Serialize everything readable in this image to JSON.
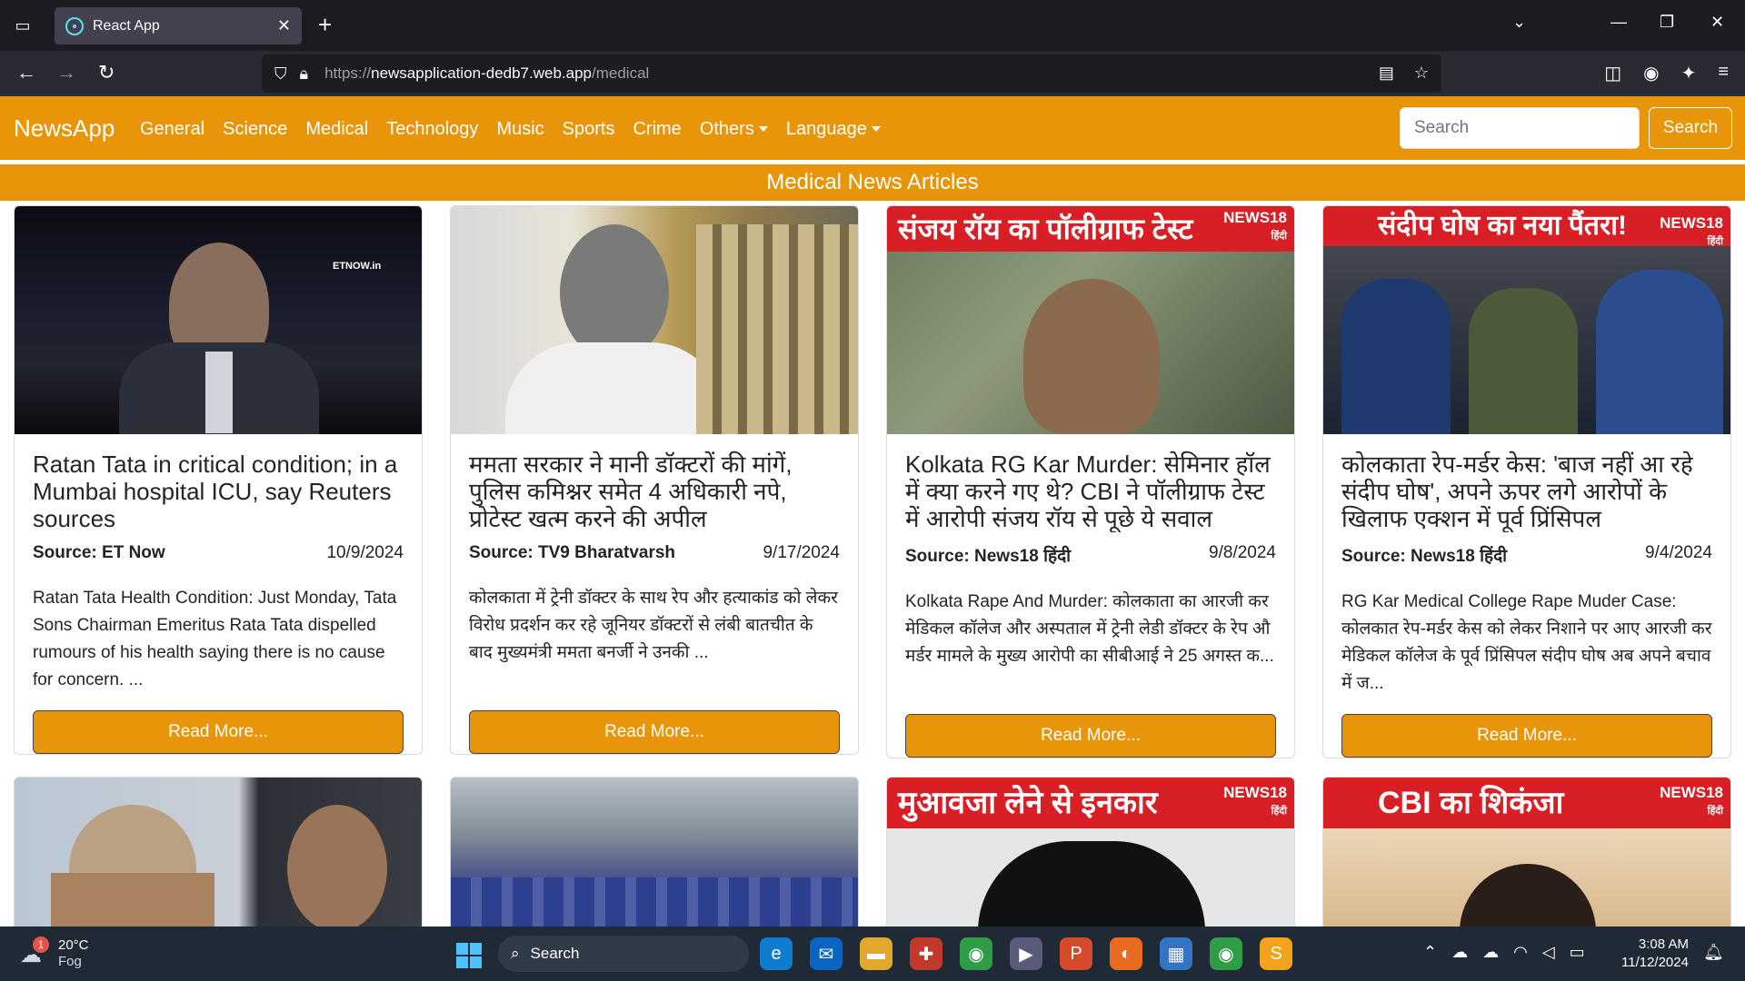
{
  "browser": {
    "tab_title": "React App",
    "url_prefix": "https://",
    "url_host": "newsapplication-dedb7.web.app",
    "url_path": "/medical"
  },
  "app": {
    "brand": "NewsApp",
    "menu": [
      "General",
      "Science",
      "Medical",
      "Technology",
      "Music",
      "Sports",
      "Crime"
    ],
    "others_label": "Others",
    "language_label": "Language",
    "search_placeholder": "Search",
    "search_button": "Search",
    "page_heading": "Medical News Articles"
  },
  "cards": [
    {
      "title": "Ratan Tata in critical condition; in a Mumbai hospital ICU, say Reuters sources",
      "source": "Source: ET Now",
      "date": "10/9/2024",
      "description": "Ratan Tata Health Condition: Just Monday, Tata Sons Chairman Emeritus Rata Tata dispelled rumours of his health saying there is no cause for concern. ...",
      "button": "Read More...",
      "image_overlay": "ETNOW.in"
    },
    {
      "title": "ममता सरकार ने मानी डॉक्टरों की मांगें, पुलिस कमिश्नर समेत 4 अधिकारी नपे, प्रोटेस्ट खत्म करने की अपील",
      "source": "Source: TV9 Bharatvarsh",
      "date": "9/17/2024",
      "description": "कोलकाता में ट्रेनी डॉक्टर के साथ रेप और हत्याकांड को लेकर विरोध प्रदर्शन कर रहे जूनियर डॉक्टरों से लंबी बातचीत के बाद मुख्यमंत्री ममता बनर्जी ने उनकी ...",
      "button": "Read More...",
      "image_overlay": ""
    },
    {
      "title": "Kolkata RG Kar Murder: सेमिनार हॉल में क्या करने गए थे? CBI ने पॉलीग्राफ टेस्ट में आरोपी संजय रॉय से पूछे ये सवाल",
      "source": "Source: News18 हिंदी",
      "date": "9/8/2024",
      "description": "Kolkata Rape And Murder: कोलकाता का आरजी कर मेडिकल कॉलेज और अस्पताल में ट्रेनी लेडी डॉक्टर के रेप औ मर्डर मामले के मुख्य आरोपी का सीबीआई ने 25 अगस्त क...",
      "button": "Read More...",
      "image_overlay": "संजय रॉय का पॉलीग्राफ टेस्ट"
    },
    {
      "title": "कोलकाता रेप-मर्डर केस: 'बाज नहीं आ रहे संदीप घोष', अपने ऊपर लगे आरोपों के खिलाफ एक्शन में पूर्व प्रिंसिपल",
      "source": "Source: News18 हिंदी",
      "date": "9/4/2024",
      "description": "RG Kar Medical College Rape Muder Case: कोलकात रेप-मर्डर केस को लेकर निशाने पर आए आरजी कर मेडिकल कॉलेज के पूर्व प्रिंसिपल संदीप घोष अब अपने बचाव में ज...",
      "button": "Read More...",
      "image_overlay": "संदीप घोष का नया पैंतरा!"
    }
  ],
  "second_row": [
    {
      "image_overlay": ""
    },
    {
      "image_overlay": ""
    },
    {
      "image_overlay": "मुआवजा लेने से इनकार"
    },
    {
      "image_overlay": "CBI का शिकंजा"
    }
  ],
  "news18_logo": {
    "brand": "NEWS18",
    "sub": "हिंदी"
  },
  "taskbar": {
    "weather_temp": "20°C",
    "weather_desc": "Fog",
    "weather_badge": "1",
    "search_label": "Search",
    "time": "3:08 AM",
    "date": "11/12/2024"
  }
}
